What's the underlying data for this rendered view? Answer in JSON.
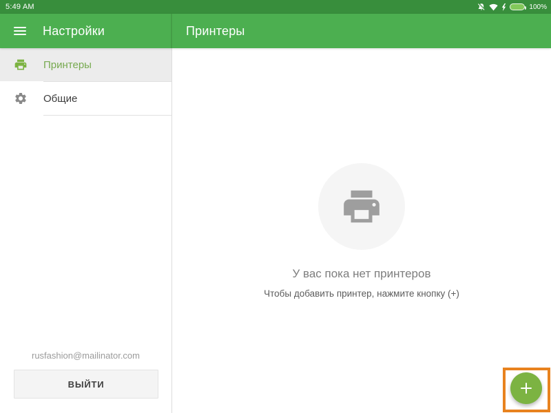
{
  "status_bar": {
    "time": "5:49 AM",
    "battery_percent": "100%"
  },
  "app_bar": {
    "menu_title": "Настройки",
    "content_title": "Принтеры"
  },
  "sidebar": {
    "items": [
      {
        "label": "Принтеры",
        "icon": "printer-icon",
        "selected": true
      },
      {
        "label": "Общие",
        "icon": "gear-icon",
        "selected": false
      }
    ],
    "account": {
      "email": "rusfashion@mailinator.com",
      "logout_label": "ВЫЙТИ"
    }
  },
  "empty_state": {
    "title": "У вас пока нет принтеров",
    "subtitle": "Чтобы добавить принтер, нажмите кнопку (+)"
  },
  "fab": {
    "icon": "plus-icon"
  },
  "colors": {
    "status_bar_green": "#388E3C",
    "app_bar_green": "#4CAF50",
    "accent_green": "#7CB342",
    "selected_text_green": "#76A94F",
    "highlight_orange": "#E8821E",
    "empty_circle_gray": "#f5f5f5"
  }
}
